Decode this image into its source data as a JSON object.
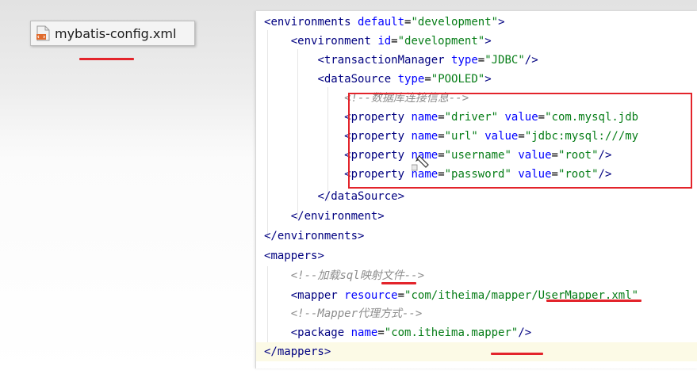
{
  "file_tab": {
    "label": "mybatis-config.xml",
    "icon": "xml-file-icon"
  },
  "colors": {
    "tag": "#000080",
    "attribute": "#0000ff",
    "value": "#067d17",
    "comment": "#8c8c8c",
    "annotation": "#e3242b"
  },
  "code": {
    "l1": {
      "open": "<",
      "tag": "environments",
      "a1": "default",
      "v1": "\"development\"",
      "close": ">"
    },
    "l2": {
      "open": "<",
      "tag": "environment",
      "a1": "id",
      "v1": "\"development\"",
      "close": ">"
    },
    "l3": {
      "open": "<",
      "tag": "transactionManager",
      "a1": "type",
      "v1": "\"JDBC\"",
      "close": "/>"
    },
    "l4": {
      "open": "<",
      "tag": "dataSource",
      "a1": "type",
      "v1": "\"POOLED\"",
      "close": ">"
    },
    "l5": {
      "comment": "<!--数据库连接信息-->"
    },
    "l6": {
      "open": "<",
      "tag": "property",
      "a1": "name",
      "v1": "\"driver\"",
      "a2": "value",
      "v2": "\"com.mysql.jdb"
    },
    "l7": {
      "open": "<",
      "tag": "property",
      "a1": "name",
      "v1": "\"url\"",
      "a2": "value",
      "v2": "\"jdbc:mysql:///my"
    },
    "l8": {
      "open": "<",
      "tag": "property",
      "a1": "name",
      "v1": "\"username\"",
      "a2": "value",
      "v2": "\"root\"",
      "close": "/>"
    },
    "l9": {
      "open": "<",
      "tag": "property",
      "a1": "name",
      "v1": "\"password\"",
      "a2": "value",
      "v2": "\"root\"",
      "close": "/>"
    },
    "l10": {
      "open": "</",
      "tag": "dataSource",
      "close": ">"
    },
    "l11": {
      "open": "</",
      "tag": "environment",
      "close": ">"
    },
    "l12": {
      "open": "</",
      "tag": "environments",
      "close": ">"
    },
    "l13": {
      "open": "<",
      "tag": "mappers",
      "close": ">"
    },
    "l14": {
      "comment": "<!--加载sql映射文件-->"
    },
    "l15": {
      "open": "<",
      "tag": "mapper",
      "a1": "resource",
      "v1": "\"com/itheima/mapper/UserMapper.xml\""
    },
    "l16": {
      "comment": "<!--Mapper代理方式-->"
    },
    "l17": {
      "open": "<",
      "tag": "package",
      "a1": "name",
      "v1": "\"com.itheima.mapper\"",
      "close": "/>"
    },
    "l18": {
      "open": "</",
      "tag": "mappers",
      "close": ">"
    }
  }
}
